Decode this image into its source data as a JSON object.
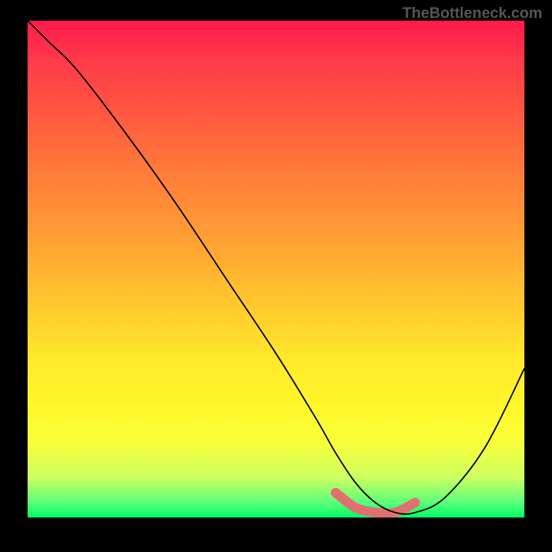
{
  "watermark": "TheBottleneck.com",
  "chart_data": {
    "type": "line",
    "title": "",
    "xlabel": "",
    "ylabel": "",
    "xlim": [
      0,
      100
    ],
    "ylim": [
      0,
      100
    ],
    "grid": false,
    "legend": false,
    "series": [
      {
        "name": "bottleneck-curve",
        "x": [
          0,
          4,
          10,
          20,
          30,
          40,
          50,
          58,
          62,
          66,
          70,
          74,
          78,
          84,
          92,
          100
        ],
        "y": [
          100,
          96,
          90,
          77,
          63,
          48,
          33,
          20,
          13,
          7,
          3,
          1,
          1,
          4,
          14,
          30
        ],
        "color": "#000000"
      },
      {
        "name": "optimal-range",
        "x": [
          62,
          66,
          70,
          74,
          78
        ],
        "y": [
          5,
          2,
          1,
          1,
          3
        ],
        "color": "#e07070"
      }
    ]
  }
}
